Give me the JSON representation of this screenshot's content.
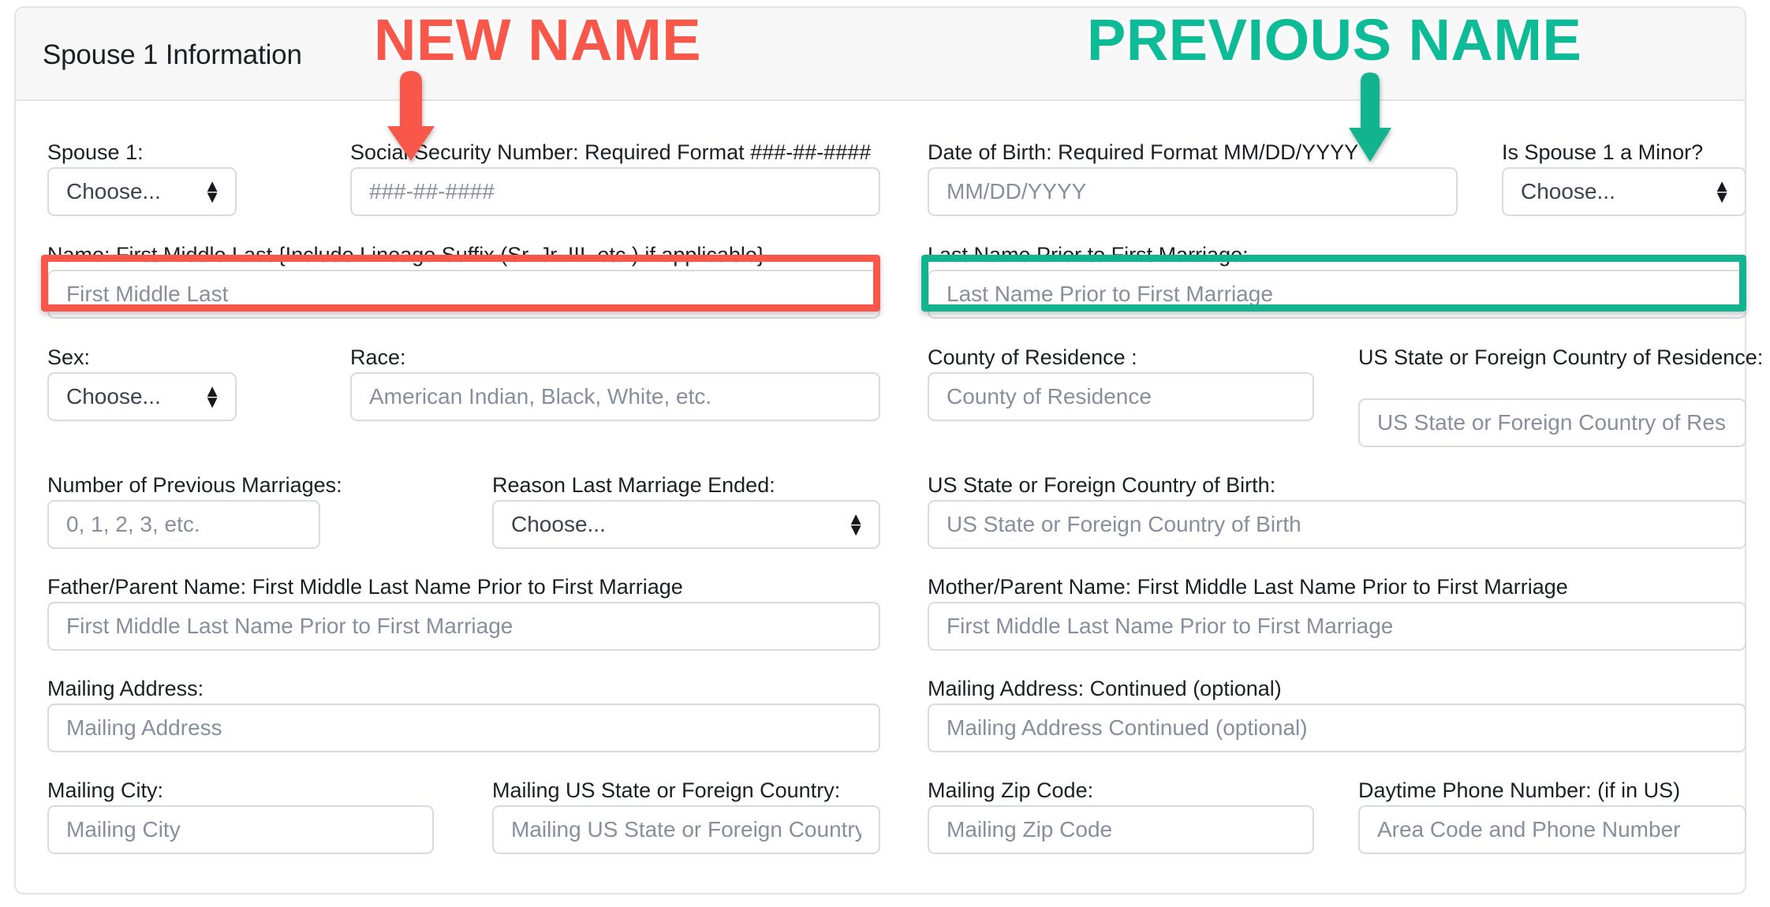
{
  "card": {
    "title": "Spouse 1 Information"
  },
  "annotations": [
    {
      "text": "NEW NAME",
      "color": "#f8574a",
      "arrow": "down-arrow"
    },
    {
      "text": "PREVIOUS NAME",
      "color": "#0ebb97",
      "arrow": "down-arrow"
    }
  ],
  "highlights": {
    "new_name_ring_color": "#f8574a",
    "previous_name_ring_color": "#12b48f"
  },
  "fields": [
    {
      "id": "spouse-1",
      "label": "Spouse 1:",
      "type": "select",
      "value": "Choose..."
    },
    {
      "id": "social-security-number",
      "label": "Social Security Number: Required Format ###-##-####",
      "type": "input",
      "placeholder": "###-##-####"
    },
    {
      "id": "date-of-birth",
      "label": "Date of Birth: Required Format MM/DD/YYYY",
      "type": "input",
      "placeholder": "MM/DD/YYYY"
    },
    {
      "id": "is-spouse-1-a-minor",
      "label": "Is Spouse 1 a Minor?",
      "type": "select",
      "value": "Choose..."
    },
    {
      "id": "name",
      "label": "Name: First Middle Last {Include Lineage Suffix (Sr. Jr. III. etc.) if applicable}",
      "type": "input",
      "placeholder": "First Middle Last"
    },
    {
      "id": "last-name-prior-to-first-marriage",
      "label": "Last Name Prior to First Marriage:",
      "type": "input",
      "placeholder": "Last Name Prior to First Marriage"
    },
    {
      "id": "sex",
      "label": "Sex:",
      "type": "select",
      "value": "Choose..."
    },
    {
      "id": "race",
      "label": "Race:",
      "type": "input",
      "placeholder": "American Indian, Black, White, etc."
    },
    {
      "id": "county-of-residence",
      "label": "County of Residence :",
      "type": "input",
      "placeholder": "County of Residence"
    },
    {
      "id": "state-or-country-of-residence",
      "label": "US State or Foreign Country of Residence:",
      "type": "input",
      "placeholder": "US State or Foreign Country of Resider"
    },
    {
      "id": "number-of-previous-marriages",
      "label": "Number of Previous Marriages:",
      "type": "input",
      "placeholder": "0, 1, 2, 3, etc."
    },
    {
      "id": "reason-last-marriage-ended",
      "label": "Reason Last Marriage Ended:",
      "type": "select",
      "value": "Choose..."
    },
    {
      "id": "state-or-country-of-birth",
      "label": "US State or Foreign Country of Birth:",
      "type": "input",
      "placeholder": "US State or Foreign Country of Birth"
    },
    {
      "id": "father-parent-name",
      "label": "Father/Parent Name: First Middle Last Name Prior to First Marriage",
      "type": "input",
      "placeholder": "First Middle Last Name Prior to First Marriage"
    },
    {
      "id": "mother-parent-name",
      "label": "Mother/Parent Name: First Middle Last Name Prior to First Marriage",
      "type": "input",
      "placeholder": "First Middle Last Name Prior to First Marriage"
    },
    {
      "id": "mailing-address",
      "label": "Mailing Address:",
      "type": "input",
      "placeholder": "Mailing Address"
    },
    {
      "id": "mailing-address-continued",
      "label": "Mailing Address: Continued (optional)",
      "type": "input",
      "placeholder": "Mailing Address Continued (optional)"
    },
    {
      "id": "mailing-city",
      "label": "Mailing City:",
      "type": "input",
      "placeholder": "Mailing City"
    },
    {
      "id": "mailing-state-or-country",
      "label": "Mailing US State or Foreign Country:",
      "type": "input",
      "placeholder": "Mailing US State or Foreign Country"
    },
    {
      "id": "mailing-zip-code",
      "label": "Mailing Zip Code:",
      "type": "input",
      "placeholder": "Mailing Zip Code"
    },
    {
      "id": "daytime-phone-number",
      "label": "Daytime Phone Number: (if in US)",
      "type": "input",
      "placeholder": "Area Code and Phone Number"
    }
  ],
  "stepper_glyphs": {
    "up": "▲",
    "down": "▼"
  }
}
